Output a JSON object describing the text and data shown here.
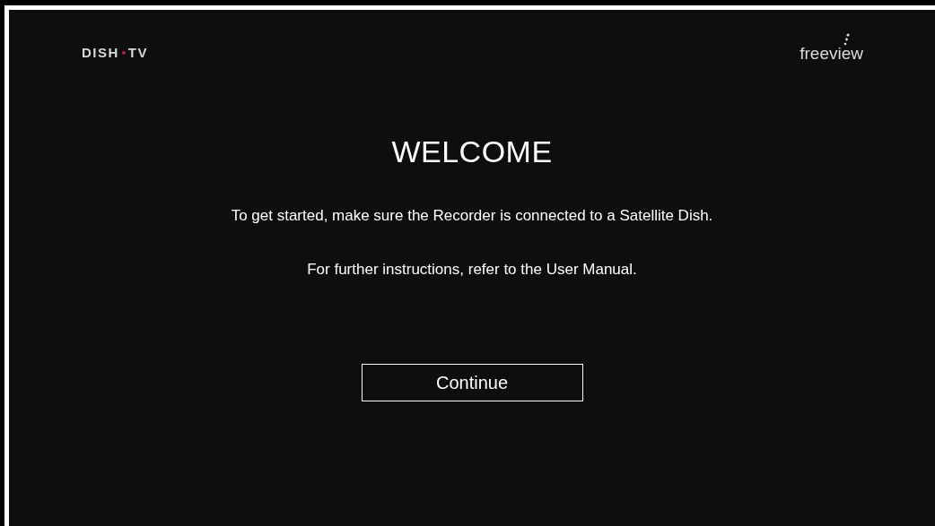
{
  "header": {
    "left_logo": {
      "word_1": "DISH",
      "word_2": "TV"
    },
    "right_logo": "freeview"
  },
  "title": "WELCOME",
  "paragraphs": [
    "To get started, make sure the Recorder is connected to a Satellite Dish.",
    "For further instructions, refer to the User Manual."
  ],
  "buttons": [
    {
      "label": "Continue",
      "selected": true
    }
  ]
}
